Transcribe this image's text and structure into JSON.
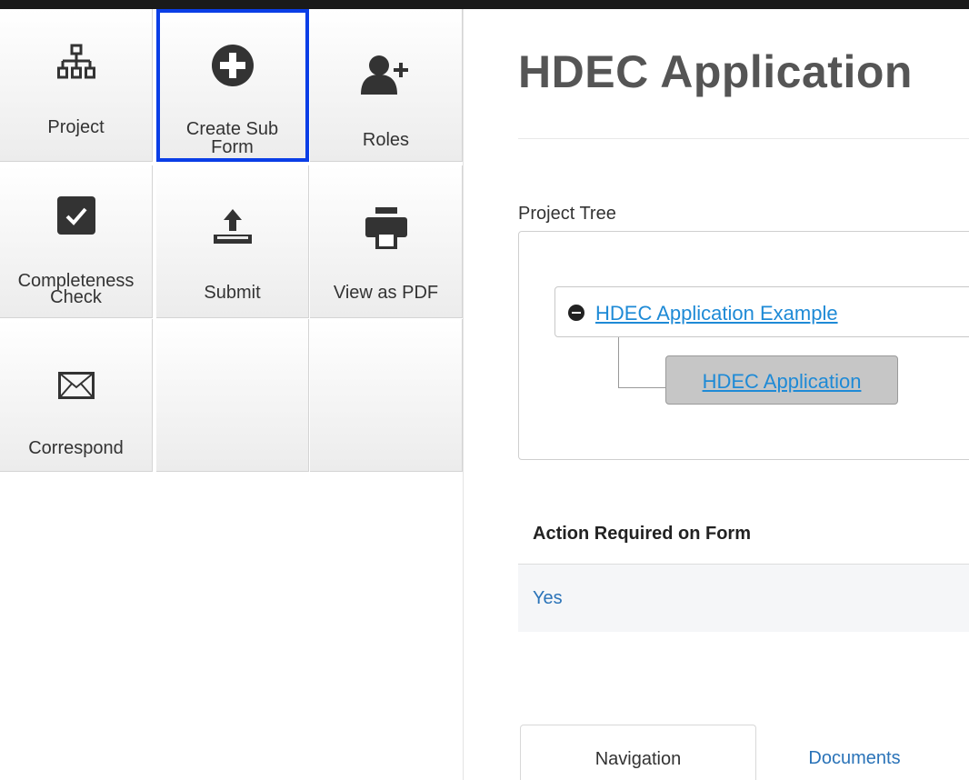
{
  "sidebar": {
    "tiles": [
      {
        "id": "project",
        "label": "Project",
        "icon": "sitemap-icon"
      },
      {
        "id": "create-sub-form",
        "label": "Create Sub\nForm",
        "icon": "plus-circle-icon",
        "highlighted": true
      },
      {
        "id": "roles",
        "label": "Roles",
        "icon": "add-user-icon"
      },
      {
        "id": "completeness-check",
        "label": "Completeness\nCheck",
        "icon": "checkbox-icon"
      },
      {
        "id": "submit",
        "label": "Submit",
        "icon": "upload-icon"
      },
      {
        "id": "view-as-pdf",
        "label": "View as PDF",
        "icon": "printer-icon"
      },
      {
        "id": "correspond",
        "label": "Correspond",
        "icon": "envelope-icon"
      }
    ]
  },
  "main": {
    "title": "HDEC Application",
    "project_tree": {
      "label": "Project Tree",
      "root_node": "HDEC Application Example",
      "child_node": "HDEC Application"
    },
    "action_required": {
      "header": "Action Required on Form",
      "value": "Yes"
    },
    "tabs": [
      {
        "label": "Navigation",
        "active": true
      },
      {
        "label": "Documents",
        "active": false
      }
    ]
  },
  "colors": {
    "highlight_border": "#0a3ee6",
    "link": "#1e8ad6",
    "title": "#555555"
  }
}
